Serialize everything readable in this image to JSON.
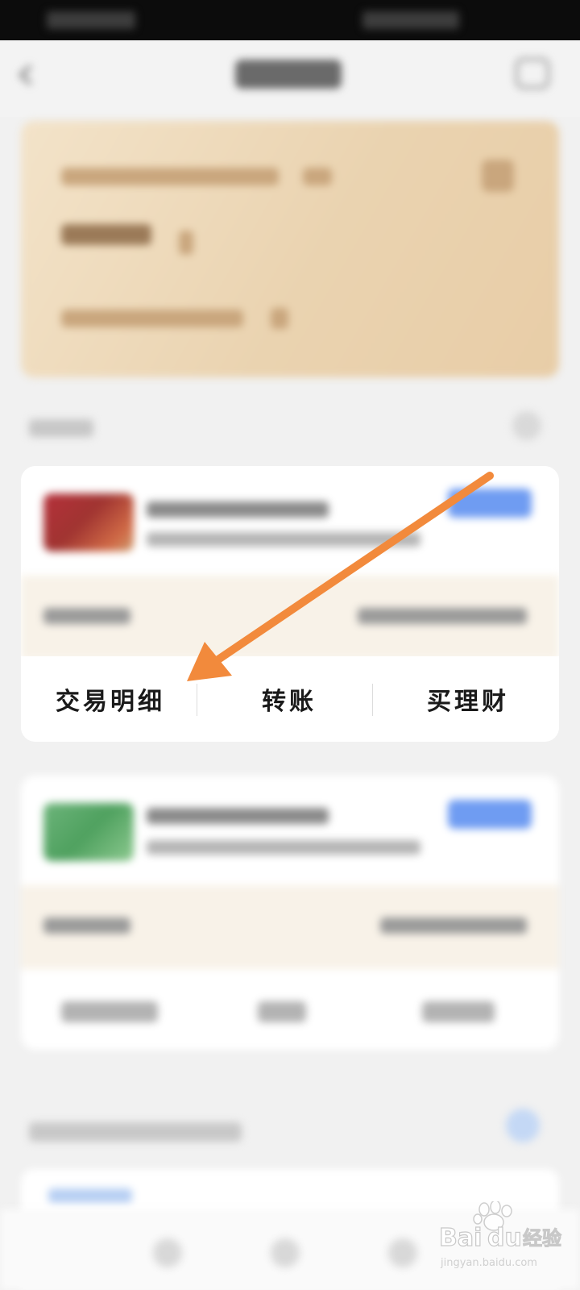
{
  "account_card": {
    "actions": [
      {
        "label": "交易明细"
      },
      {
        "label": "转账"
      },
      {
        "label": "买理财"
      }
    ]
  },
  "watermark": {
    "brand_text": "Bai",
    "brand_text_2": "du",
    "product_text": "经验",
    "url_text": "jingyan.baidu.com"
  },
  "colors": {
    "annotation_arrow": "#f28a3c",
    "badge_blue": "#6f9cf2",
    "gold_card": "#ead3b0"
  }
}
